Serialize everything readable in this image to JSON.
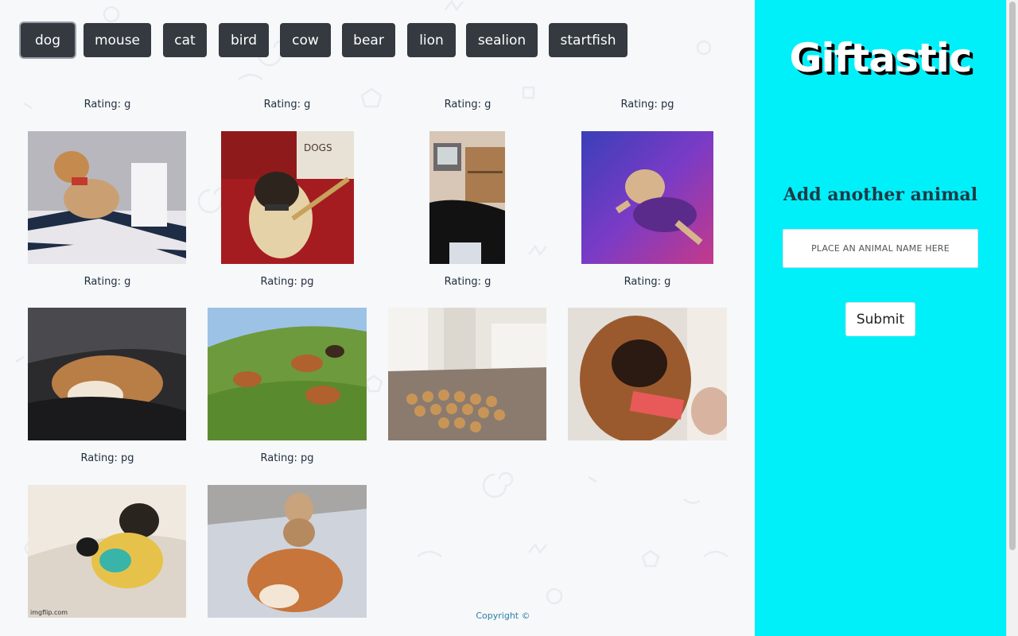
{
  "buttons": [
    {
      "label": "dog",
      "active": true
    },
    {
      "label": "mouse"
    },
    {
      "label": "cat"
    },
    {
      "label": "bird"
    },
    {
      "label": "cow"
    },
    {
      "label": "bear"
    },
    {
      "label": "lion"
    },
    {
      "label": "sealion"
    },
    {
      "label": "startfish"
    }
  ],
  "gifs": [
    {
      "rating": "Rating: g",
      "scene": "shiba-laptop-icon"
    },
    {
      "rating": "Rating: g",
      "scene": "pug-backscratcher-icon"
    },
    {
      "rating": "Rating: g",
      "scene": "cat-tv-room-icon"
    },
    {
      "rating": "Rating: pg",
      "scene": "flying-bulldog-icon"
    },
    {
      "rating": "Rating: g",
      "scene": "sleeping-dog-icon"
    },
    {
      "rating": "Rating: pg",
      "scene": "hotdog-dogs-field-icon"
    },
    {
      "rating": "Rating: g",
      "scene": "cookies-kitchen-icon"
    },
    {
      "rating": "Rating: g",
      "scene": "dog-popsicle-icon"
    },
    {
      "rating": "Rating: pg",
      "scene": "pug-sweater-icon"
    },
    {
      "rating": "Rating: pg",
      "scene": "shiba-with-puppy-icon"
    }
  ],
  "footer": {
    "copyright": "Copyright ©"
  },
  "sidebar": {
    "title": "Giftastic",
    "add_heading": "Add another animal",
    "input_placeholder": "PLACE AN ANIMAL NAME HERE",
    "input_value": "",
    "submit_label": "Submit"
  },
  "colors": {
    "sidebar_bg": "#00f0fa",
    "button_bg": "#343a40",
    "page_bg": "#f7f8fa"
  }
}
